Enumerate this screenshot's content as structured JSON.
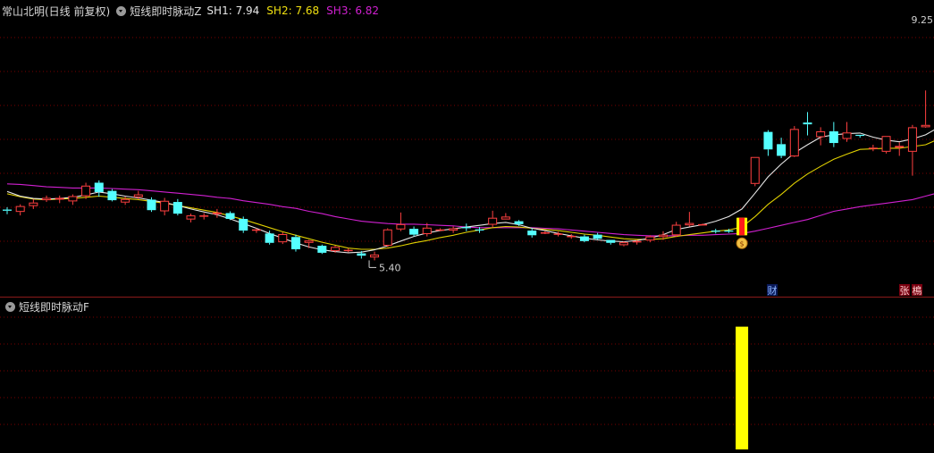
{
  "header": {
    "stock_title": "常山北明(日线 前复权)",
    "indicator_name": "短线即时脉动Z",
    "sh1": {
      "label": "SH1:",
      "value": "7.94",
      "color": "#e6e6e6"
    },
    "sh2": {
      "label": "SH2:",
      "value": "7.68",
      "color": "#f0e010"
    },
    "sh3": {
      "label": "SH3:",
      "value": "6.82",
      "color": "#d020d0"
    }
  },
  "sub_header": {
    "indicator_name": "短线即时脉动F"
  },
  "colors": {
    "up": "#ff4040",
    "down": "#54ffff",
    "grid": "#7a0000",
    "signal_bar": "#ffff00",
    "sh1_line": "#e6e6e6",
    "sh2_line": "#e0d000",
    "sh3_line": "#d020d0"
  },
  "markers": {
    "low_price": "5.40",
    "high_price": "9.25",
    "cai_badge": "财",
    "zhang_badge": "张",
    "tiao_badge": "樢"
  },
  "chart_data": {
    "type": "candlestick",
    "ylim": [
      5.15,
      9.45
    ],
    "candles": [
      [
        6.32,
        6.36,
        6.24,
        6.3
      ],
      [
        6.28,
        6.41,
        6.22,
        6.38
      ],
      [
        6.38,
        6.5,
        6.33,
        6.44
      ],
      [
        6.48,
        6.56,
        6.45,
        6.52
      ],
      [
        6.49,
        6.56,
        6.43,
        6.52
      ],
      [
        6.46,
        6.58,
        6.4,
        6.55
      ],
      [
        6.55,
        6.78,
        6.5,
        6.73
      ],
      [
        6.78,
        6.82,
        6.54,
        6.62
      ],
      [
        6.64,
        6.67,
        6.46,
        6.48
      ],
      [
        6.44,
        6.54,
        6.4,
        6.5
      ],
      [
        6.53,
        6.64,
        6.5,
        6.58
      ],
      [
        6.49,
        6.53,
        6.28,
        6.31
      ],
      [
        6.29,
        6.52,
        6.22,
        6.47
      ],
      [
        6.45,
        6.5,
        6.22,
        6.25
      ],
      [
        6.15,
        6.25,
        6.1,
        6.22
      ],
      [
        6.21,
        6.26,
        6.15,
        6.22
      ],
      [
        6.24,
        6.33,
        6.18,
        6.27
      ],
      [
        6.26,
        6.29,
        6.14,
        6.16
      ],
      [
        6.16,
        6.2,
        5.92,
        5.96
      ],
      [
        5.96,
        6.0,
        5.92,
        5.98
      ],
      [
        5.91,
        5.96,
        5.72,
        5.75
      ],
      [
        5.76,
        5.93,
        5.73,
        5.9
      ],
      [
        5.85,
        5.89,
        5.6,
        5.64
      ],
      [
        5.75,
        5.8,
        5.66,
        5.79
      ],
      [
        5.7,
        5.72,
        5.56,
        5.58
      ],
      [
        5.61,
        5.7,
        5.58,
        5.68
      ],
      [
        5.62,
        5.66,
        5.59,
        5.63
      ],
      [
        5.57,
        5.61,
        5.48,
        5.53
      ],
      [
        5.5,
        5.6,
        5.45,
        5.55
      ],
      [
        5.7,
        6.0,
        5.68,
        5.98
      ],
      [
        5.98,
        6.27,
        5.95,
        6.07
      ],
      [
        5.99,
        6.03,
        5.86,
        5.89
      ],
      [
        5.9,
        6.09,
        5.86,
        6.01
      ],
      [
        5.97,
        6.0,
        5.95,
        5.98
      ],
      [
        5.96,
        6.03,
        5.92,
        6.0
      ],
      [
        6.02,
        6.08,
        5.95,
        6.0
      ],
      [
        5.98,
        6.02,
        5.92,
        5.97
      ],
      [
        6.06,
        6.3,
        6.02,
        6.18
      ],
      [
        6.15,
        6.26,
        6.15,
        6.2
      ],
      [
        6.12,
        6.14,
        6.04,
        6.07
      ],
      [
        5.96,
        6.0,
        5.84,
        5.88
      ],
      [
        5.93,
        5.95,
        5.9,
        5.93
      ],
      [
        5.89,
        5.94,
        5.86,
        5.91
      ],
      [
        5.86,
        5.9,
        5.82,
        5.87
      ],
      [
        5.86,
        5.89,
        5.76,
        5.78
      ],
      [
        5.89,
        5.92,
        5.8,
        5.82
      ],
      [
        5.8,
        5.8,
        5.72,
        5.75
      ],
      [
        5.71,
        5.78,
        5.69,
        5.76
      ],
      [
        5.77,
        5.8,
        5.72,
        5.78
      ],
      [
        5.79,
        5.88,
        5.76,
        5.86
      ],
      [
        5.85,
        5.95,
        5.8,
        5.89
      ],
      [
        5.88,
        6.11,
        5.85,
        6.06
      ],
      [
        6.05,
        6.28,
        6.03,
        6.09
      ],
      [
        6.07,
        6.08,
        6.05,
        6.07
      ],
      [
        5.96,
        5.99,
        5.91,
        5.94
      ],
      [
        5.96,
        5.99,
        5.92,
        5.95
      ],
      [
        5.88,
        6.18,
        5.88,
        6.18
      ],
      [
        6.76,
        7.21,
        6.72,
        7.22
      ],
      [
        7.65,
        7.68,
        7.24,
        7.35
      ],
      [
        7.44,
        7.55,
        7.2,
        7.24
      ],
      [
        7.23,
        7.75,
        7.22,
        7.7
      ],
      [
        7.81,
        7.99,
        7.59,
        7.78
      ],
      [
        7.56,
        7.73,
        7.42,
        7.66
      ],
      [
        7.66,
        7.82,
        7.39,
        7.46
      ],
      [
        7.53,
        7.82,
        7.48,
        7.64
      ],
      [
        7.6,
        7.59,
        7.55,
        7.59
      ],
      [
        7.36,
        7.43,
        7.32,
        7.38
      ],
      [
        7.31,
        7.58,
        7.28,
        7.58
      ],
      [
        7.38,
        7.47,
        7.24,
        7.41
      ],
      [
        7.31,
        7.77,
        6.9,
        7.73
      ],
      [
        7.73,
        8.36,
        7.72,
        7.77
      ],
      [
        7.82,
        8.59,
        7.72,
        8.44
      ],
      [
        8.16,
        8.49,
        8.09,
        8.11
      ]
    ],
    "sh1": [
      6.63,
      6.55,
      6.51,
      6.5,
      6.51,
      6.53,
      6.57,
      6.62,
      6.59,
      6.55,
      6.52,
      6.48,
      6.44,
      6.39,
      6.33,
      6.28,
      6.23,
      6.16,
      6.08,
      6.0,
      5.91,
      5.83,
      5.75,
      5.68,
      5.63,
      5.6,
      5.58,
      5.59,
      5.63,
      5.7,
      5.78,
      5.86,
      5.92,
      5.96,
      5.99,
      6.02,
      6.05,
      6.08,
      6.1,
      6.06,
      6.0,
      5.96,
      5.91,
      5.87,
      5.83,
      5.8,
      5.78,
      5.77,
      5.79,
      5.83,
      5.89,
      5.98,
      6.02,
      6.06,
      6.12,
      6.2,
      6.33,
      6.6,
      6.88,
      7.1,
      7.29,
      7.43,
      7.56,
      7.6,
      7.62,
      7.63,
      7.56,
      7.51,
      7.48,
      7.53,
      7.6,
      7.73,
      7.94
    ],
    "sh2": [
      6.59,
      6.54,
      6.5,
      6.49,
      6.5,
      6.51,
      6.53,
      6.55,
      6.53,
      6.51,
      6.49,
      6.46,
      6.43,
      6.39,
      6.35,
      6.31,
      6.27,
      6.21,
      6.15,
      6.08,
      6.01,
      5.94,
      5.88,
      5.82,
      5.76,
      5.71,
      5.66,
      5.64,
      5.64,
      5.66,
      5.7,
      5.75,
      5.79,
      5.84,
      5.88,
      5.93,
      5.97,
      6.01,
      6.03,
      6.02,
      6.0,
      5.98,
      5.96,
      5.93,
      5.9,
      5.88,
      5.85,
      5.82,
      5.81,
      5.81,
      5.82,
      5.86,
      5.89,
      5.92,
      5.95,
      5.97,
      6.02,
      6.2,
      6.41,
      6.58,
      6.77,
      6.93,
      7.06,
      7.18,
      7.27,
      7.35,
      7.36,
      7.37,
      7.37,
      7.4,
      7.43,
      7.53,
      7.68
    ],
    "sh3": [
      6.76,
      6.75,
      6.73,
      6.71,
      6.7,
      6.69,
      6.69,
      6.69,
      6.68,
      6.67,
      6.66,
      6.64,
      6.62,
      6.6,
      6.58,
      6.56,
      6.53,
      6.51,
      6.47,
      6.44,
      6.41,
      6.37,
      6.34,
      6.29,
      6.25,
      6.2,
      6.16,
      6.12,
      6.1,
      6.08,
      6.07,
      6.07,
      6.06,
      6.05,
      6.04,
      6.02,
      6.01,
      6.01,
      6.01,
      6.01,
      6.01,
      6.0,
      5.99,
      5.97,
      5.95,
      5.93,
      5.91,
      5.89,
      5.88,
      5.87,
      5.87,
      5.87,
      5.88,
      5.88,
      5.89,
      5.9,
      5.91,
      5.95,
      6.0,
      6.05,
      6.1,
      6.15,
      6.22,
      6.29,
      6.33,
      6.37,
      6.4,
      6.43,
      6.46,
      6.49,
      6.55,
      6.61,
      6.82
    ],
    "signal_index": 56,
    "signal_bar_value": 1.0,
    "signal_ylim": [
      0,
      1.15
    ]
  }
}
